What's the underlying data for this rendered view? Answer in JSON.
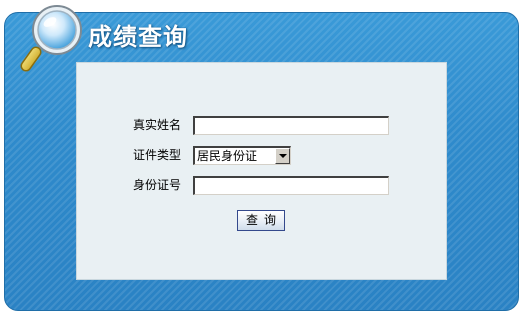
{
  "header": {
    "title": "成绩查询"
  },
  "form": {
    "name_label": "真实姓名",
    "name_value": "",
    "id_type_label": "证件类型",
    "id_type_selected": "居民身份证",
    "id_number_label": "身份证号",
    "id_number_value": "",
    "submit_label": "查询"
  },
  "colors": {
    "frame_blue": "#2f8bcc",
    "panel_bg": "#e9f0f3",
    "button_border": "#34498c"
  },
  "icons": {
    "header_icon": "magnifier-icon",
    "select_icon": "chevron-down-icon"
  }
}
